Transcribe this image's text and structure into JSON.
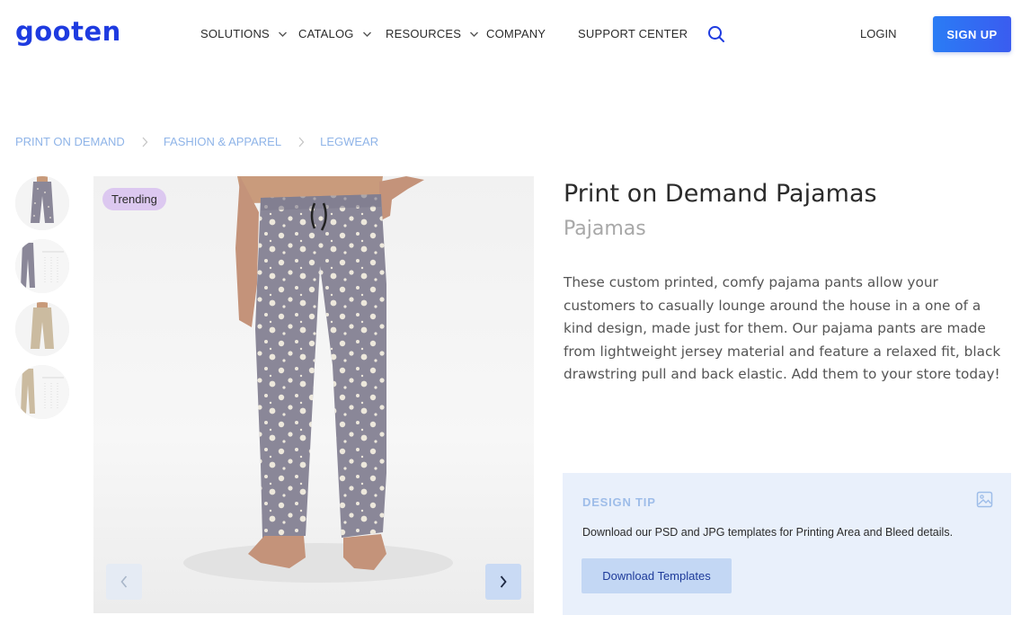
{
  "header": {
    "logo_text": "gooten",
    "nav": [
      {
        "label": "SOLUTIONS",
        "has_dropdown": true
      },
      {
        "label": "CATALOG",
        "has_dropdown": true
      },
      {
        "label": "RESOURCES",
        "has_dropdown": true
      },
      {
        "label": "COMPANY",
        "has_dropdown": false
      },
      {
        "label": "SUPPORT CENTER",
        "has_dropdown": false
      }
    ],
    "search_icon": "search-icon",
    "login_label": "LOGIN",
    "signup_label": "SIGN UP"
  },
  "breadcrumb": [
    {
      "label": "PRINT ON DEMAND"
    },
    {
      "label": "FASHION & APPAREL"
    },
    {
      "label": "LEGWEAR"
    }
  ],
  "gallery": {
    "thumbnails": [
      {
        "icon": "pajama-front-thumbnail"
      },
      {
        "icon": "pajama-size-chart-thumbnail"
      },
      {
        "icon": "khaki-pajama-thumbnail"
      },
      {
        "icon": "khaki-size-chart-thumbnail"
      }
    ],
    "badge": "Trending",
    "prev_icon": "chevron-left-icon",
    "next_icon": "chevron-right-icon"
  },
  "product": {
    "title": "Print on Demand Pajamas",
    "subtitle": "Pajamas",
    "description": "These custom printed, comfy pajama pants allow your customers to casually lounge around the house in a one of a kind design, made just for them. Our pajama pants are made from lightweight jersey material and feature a relaxed fit, black drawstring pull and back elastic. Add them to your store today!"
  },
  "design_tip": {
    "label": "DESIGN TIP",
    "icon": "image-icon",
    "text": "Download our PSD and JPG templates for Printing Area and Bleed details.",
    "button_label": "Download Templates"
  },
  "colors": {
    "brand": "#1e3be0",
    "signup_gradient_start": "#2a7cf5",
    "signup_gradient_end": "#3a5cf0",
    "breadcrumb": "#8fb4e8",
    "badge_bg": "#dcc8f0",
    "tip_bg": "#e9f0fb",
    "pajama_fabric": "#8a8798",
    "pajama_dots": "#ede8dc"
  }
}
